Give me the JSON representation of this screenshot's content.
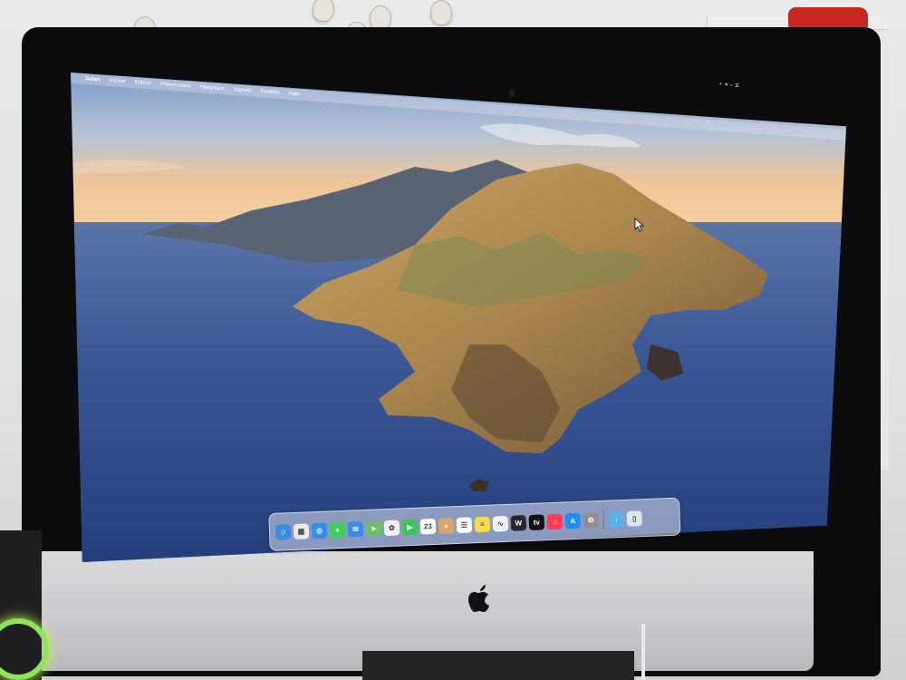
{
  "menubar": {
    "apple_symbol": "",
    "app_name": "Safari",
    "items": [
      "Fichier",
      "Édition",
      "Présentation",
      "Historique",
      "Signets",
      "Fenêtre",
      "Aide"
    ]
  },
  "dock": {
    "icons": [
      {
        "name": "finder-icon",
        "color": "#3a8dde",
        "glyph": "☺"
      },
      {
        "name": "launchpad-icon",
        "color": "#e8e8ee",
        "glyph": "▦"
      },
      {
        "name": "safari-icon",
        "color": "#2f8fe9",
        "glyph": "◎"
      },
      {
        "name": "messages-icon",
        "color": "#3fcf5a",
        "glyph": "●"
      },
      {
        "name": "mail-icon",
        "color": "#3b8be8",
        "glyph": "✉"
      },
      {
        "name": "maps-icon",
        "color": "#6fbf6a",
        "glyph": "➤"
      },
      {
        "name": "photos-icon",
        "color": "#f3f0f5",
        "glyph": "✿"
      },
      {
        "name": "facetime-icon",
        "color": "#34c759",
        "glyph": "▶"
      },
      {
        "name": "calendar-icon",
        "color": "#ffffff",
        "glyph": "23"
      },
      {
        "name": "contacts-icon",
        "color": "#d8a56a",
        "glyph": "◕"
      },
      {
        "name": "reminders-icon",
        "color": "#ffffff",
        "glyph": "☰"
      },
      {
        "name": "notes-icon",
        "color": "#f5d94e",
        "glyph": "≡"
      },
      {
        "name": "freeform-icon",
        "color": "#f2f2f2",
        "glyph": "∿"
      },
      {
        "name": "warcraft-icon",
        "color": "#2a2530",
        "glyph": "W"
      },
      {
        "name": "apple-tv-icon",
        "color": "#111111",
        "glyph": "tv"
      },
      {
        "name": "music-icon",
        "color": "#fa3c54",
        "glyph": "♫"
      },
      {
        "name": "app-store-icon",
        "color": "#1f8ef5",
        "glyph": "A"
      },
      {
        "name": "system-preferences-icon",
        "color": "#8e8e93",
        "glyph": "⚙"
      }
    ],
    "right_icons": [
      {
        "name": "downloads-folder-icon",
        "color": "#5ab0e8",
        "glyph": "↓"
      },
      {
        "name": "trash-icon",
        "color": "#dfe3ea",
        "glyph": "▯"
      }
    ]
  },
  "colors": {
    "sea": "#2c4c8e",
    "sky": "#9fb6d6",
    "sunset": "#f1c48a",
    "island": "#b08a52"
  }
}
